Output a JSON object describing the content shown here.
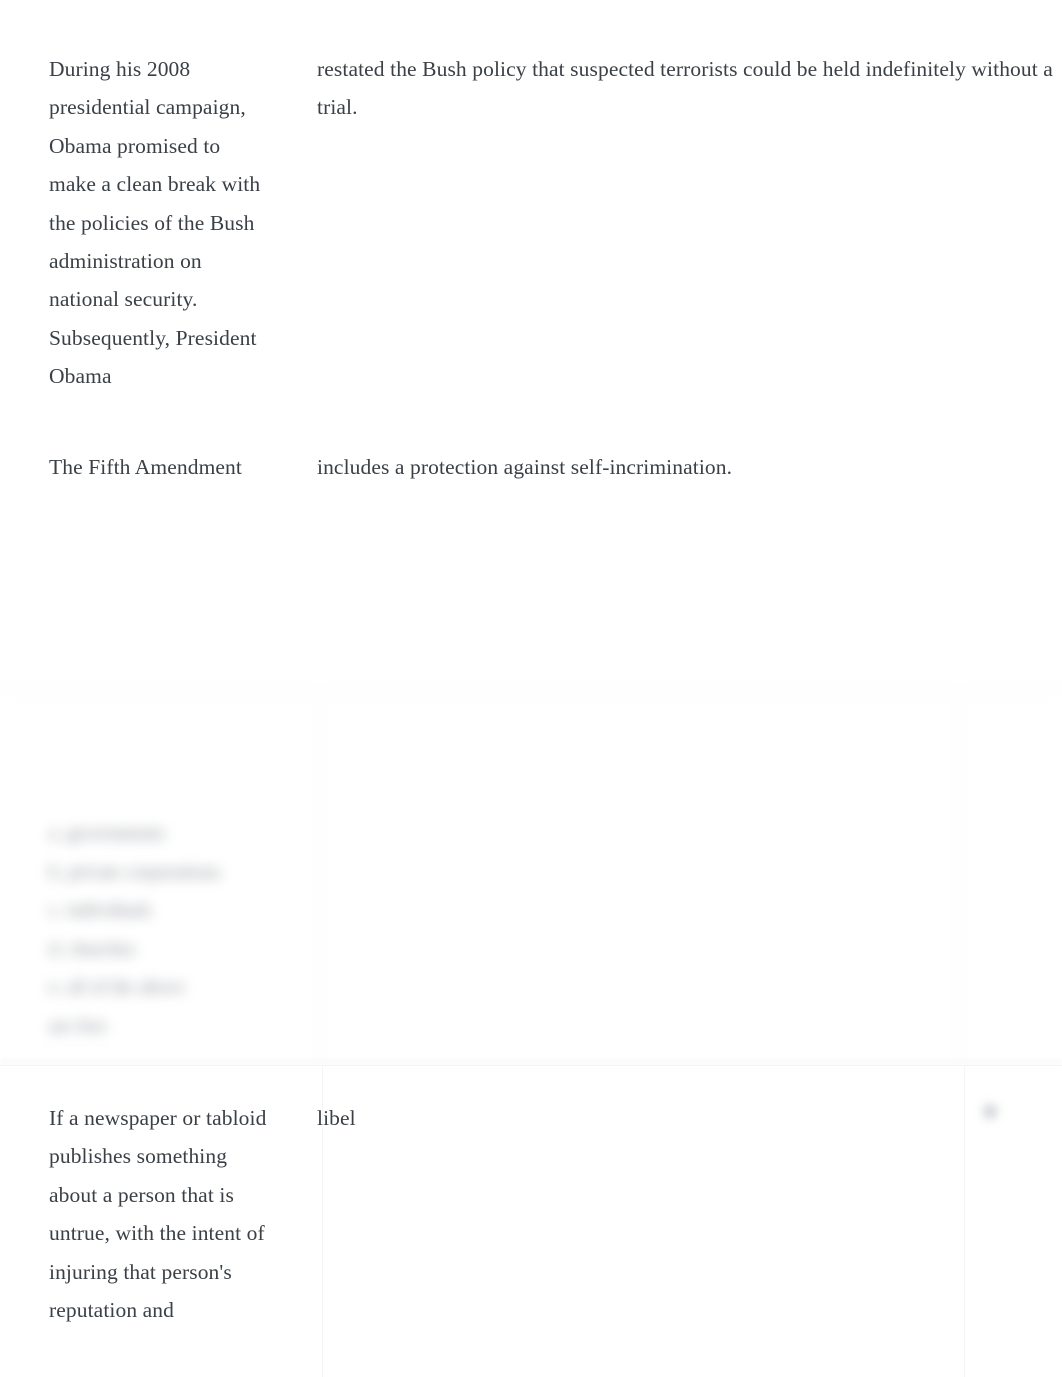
{
  "meta": {
    "text_color": "#3a4046",
    "background": "#ffffff",
    "muted_color": "#80878d"
  },
  "cards": [
    {
      "id": "obama",
      "term": "During his 2008 presidential campaign, Obama promised to make a clean break with the policies of the Bush administration on national security. Subsequently, President Obama",
      "definition": "restated the Bush policy that suspected terrorists could be held indefinitely without a trial."
    },
    {
      "id": "fifth-amendment",
      "term": "The Fifth Amendment",
      "definition": "includes a protection against self-incrimination."
    },
    {
      "id": "obscured",
      "blurred": true,
      "prompt": "",
      "choices": [
        "a. governments",
        "b. private corporations",
        "c. individuals",
        "d. churches",
        "e. all of the above",
        "are free"
      ]
    },
    {
      "id": "libel",
      "term": "If a newspaper or tabloid publishes something about a person that is untrue, with the intent of injuring that person's reputation and",
      "definition": "libel"
    }
  ],
  "icons": {
    "favorite": "star-icon"
  }
}
